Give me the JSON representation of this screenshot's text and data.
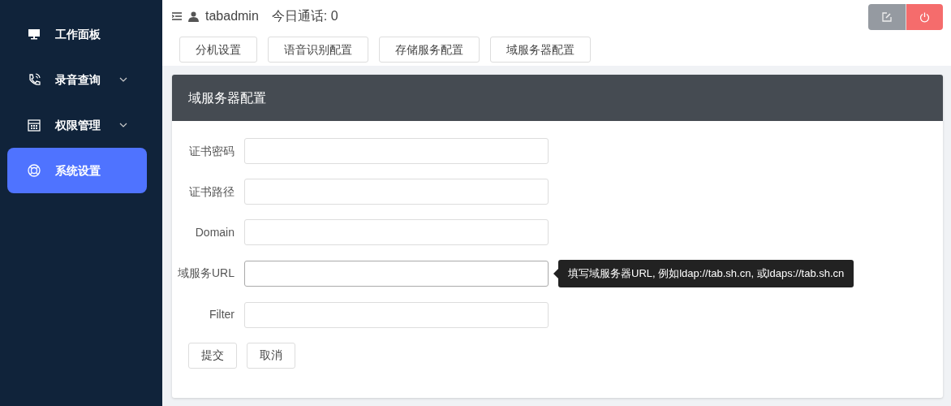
{
  "sidebar": {
    "items": [
      {
        "label": "工作面板",
        "expandable": false,
        "selected": false
      },
      {
        "label": "录音查询",
        "expandable": true,
        "selected": false
      },
      {
        "label": "权限管理",
        "expandable": true,
        "selected": false
      },
      {
        "label": "系统设置",
        "expandable": false,
        "selected": true
      }
    ]
  },
  "header": {
    "user": "tabadmin",
    "calls": "今日通话: 0"
  },
  "nav_buttons": [
    "分机设置",
    "语音识别配置",
    "存储服务配置",
    "域服务器配置"
  ],
  "panel": {
    "title": "域服务器配置",
    "fields": [
      {
        "label": "证书密码",
        "focused": false
      },
      {
        "label": "证书路径",
        "focused": false
      },
      {
        "label": "Domain",
        "focused": false
      },
      {
        "label": "域服务URL",
        "focused": true,
        "tooltip": "填写域服务器URL, 例如ldap://tab.sh.cn, 或ldaps://tab.sh.cn"
      },
      {
        "label": "Filter",
        "focused": false
      }
    ],
    "buttons": [
      "提交",
      "取消"
    ]
  }
}
